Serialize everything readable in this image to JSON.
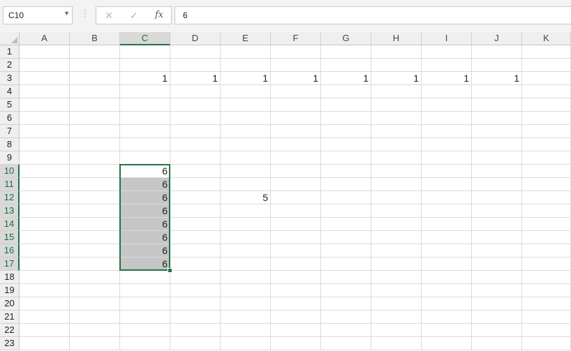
{
  "formula_bar": {
    "name_box": "C10",
    "name_box_arrow": "▼",
    "grip": "⋮",
    "cancel_icon": "✕",
    "enter_icon": "✓",
    "fx_label": "fx",
    "formula_value": "6"
  },
  "sheet": {
    "columns": [
      "A",
      "B",
      "C",
      "D",
      "E",
      "F",
      "G",
      "H",
      "I",
      "J",
      "K"
    ],
    "rows": [
      "1",
      "2",
      "3",
      "4",
      "5",
      "6",
      "7",
      "8",
      "9",
      "10",
      "11",
      "12",
      "13",
      "14",
      "15",
      "16",
      "17",
      "18",
      "19",
      "20",
      "21",
      "22",
      "23"
    ],
    "active_cell": "C10",
    "selection": "C10:C17",
    "selection_color": "#217346",
    "cells": [
      {
        "ref": "C3",
        "value": "1"
      },
      {
        "ref": "D3",
        "value": "1"
      },
      {
        "ref": "E3",
        "value": "1"
      },
      {
        "ref": "F3",
        "value": "1"
      },
      {
        "ref": "G3",
        "value": "1"
      },
      {
        "ref": "H3",
        "value": "1"
      },
      {
        "ref": "I3",
        "value": "1"
      },
      {
        "ref": "J3",
        "value": "1"
      },
      {
        "ref": "C10",
        "value": "6"
      },
      {
        "ref": "C11",
        "value": "6"
      },
      {
        "ref": "C12",
        "value": "6"
      },
      {
        "ref": "C13",
        "value": "6"
      },
      {
        "ref": "C14",
        "value": "6"
      },
      {
        "ref": "C15",
        "value": "6"
      },
      {
        "ref": "C16",
        "value": "6"
      },
      {
        "ref": "C17",
        "value": "6"
      },
      {
        "ref": "E12",
        "value": "5"
      }
    ]
  }
}
